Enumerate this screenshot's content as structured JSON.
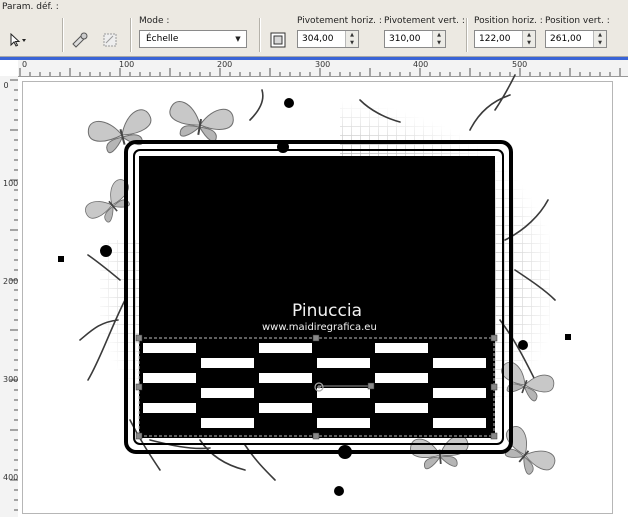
{
  "toolbar": {
    "presets_label": "Param. déf. :",
    "mode_label": "Mode :",
    "mode_value": "Échelle",
    "pivot_h_label": "Pivotement horiz. :",
    "pivot_h_value": "304,00",
    "pivot_v_label": "Pivotement vert. :",
    "pivot_v_value": "310,00",
    "pos_h_label": "Position horiz. :",
    "pos_h_value": "122,00",
    "pos_v_label": "Position vert. :",
    "pos_v_value": "261,00"
  },
  "ruler": {
    "h_ticks": [
      "0",
      "100",
      "200",
      "300",
      "400",
      "500"
    ],
    "v_ticks": [
      "0",
      "100",
      "200",
      "300",
      "400"
    ]
  },
  "watermark": {
    "name": "Pinuccia",
    "url": "www.maidiregrafica.eu"
  }
}
